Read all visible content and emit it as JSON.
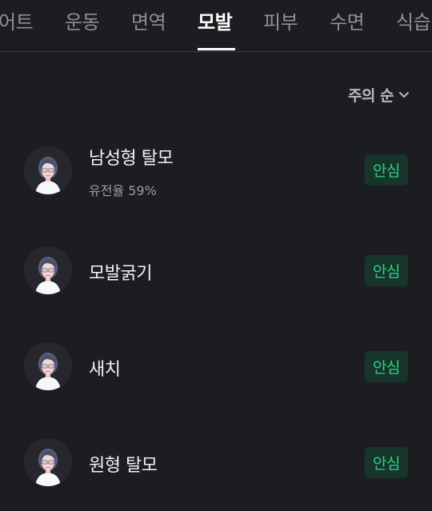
{
  "tabs": [
    {
      "label": "어트",
      "active": false
    },
    {
      "label": "운동",
      "active": false
    },
    {
      "label": "면역",
      "active": false
    },
    {
      "label": "모발",
      "active": true
    },
    {
      "label": "피부",
      "active": false
    },
    {
      "label": "수면",
      "active": false
    },
    {
      "label": "식습",
      "active": false
    }
  ],
  "sort": {
    "label": "주의 순",
    "icon": "chevron-down-icon"
  },
  "traits": [
    {
      "name": "남성형 탈모",
      "sub": "유전율 59%",
      "badge": "안심",
      "icon": "avatar-icon"
    },
    {
      "name": "모발굵기",
      "sub": "",
      "badge": "안심",
      "icon": "avatar-icon"
    },
    {
      "name": "새치",
      "sub": "",
      "badge": "안심",
      "icon": "avatar-icon"
    },
    {
      "name": "원형 탈모",
      "sub": "",
      "badge": "안심",
      "icon": "avatar-icon"
    }
  ],
  "colors": {
    "background": "#1c1d21",
    "badge_bg": "#17352a",
    "badge_text": "#2fcf86",
    "tab_inactive": "#8e9097",
    "tab_active": "#ffffff"
  }
}
